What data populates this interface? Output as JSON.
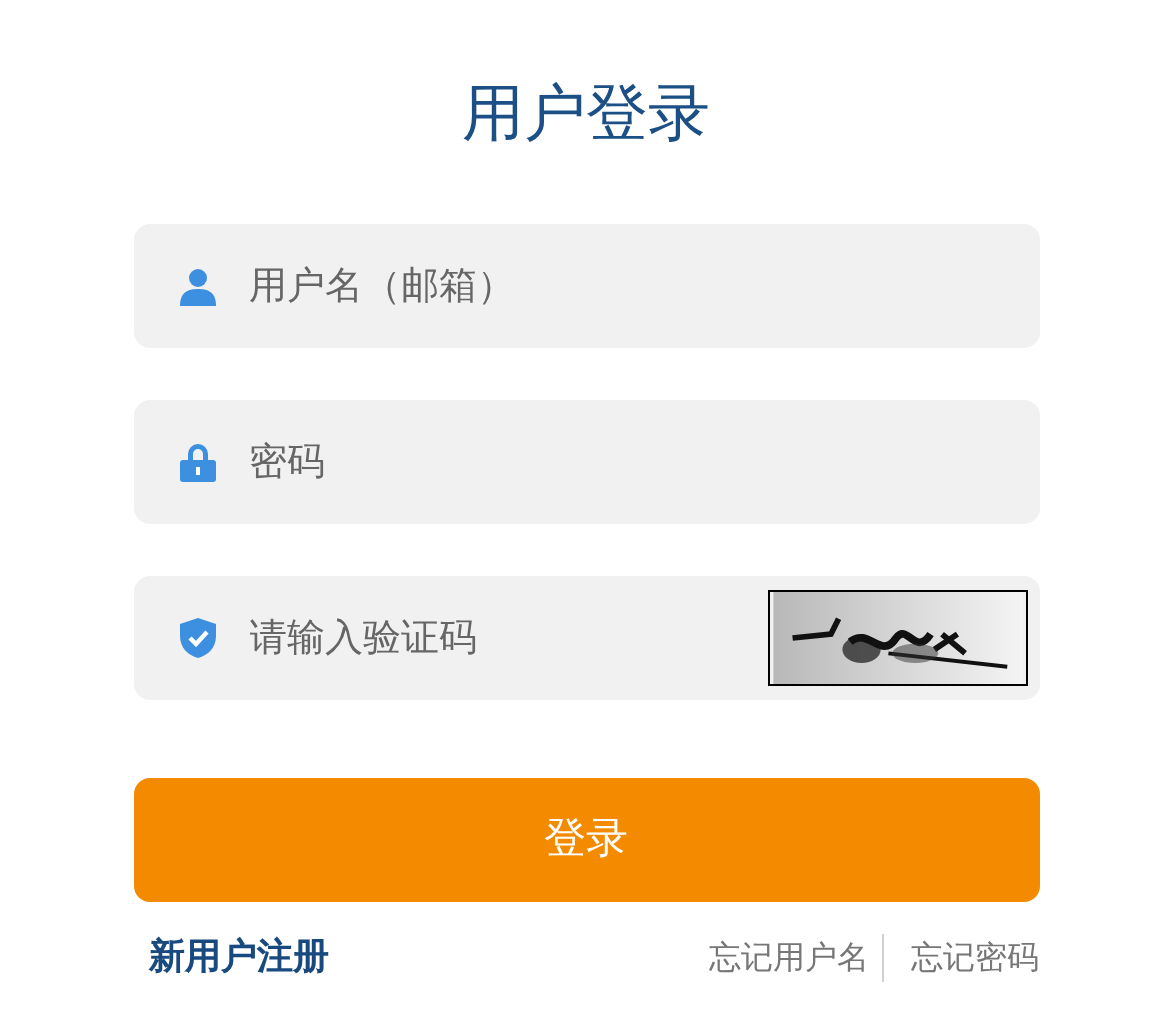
{
  "title": "用户登录",
  "fields": [
    {
      "kind": "text",
      "placeholder": "用户名（邮箱）"
    },
    {
      "kind": "password",
      "placeholder": "密码"
    },
    {
      "kind": "captcha",
      "placeholder": "请输入验证码"
    }
  ],
  "submit": "登录",
  "register_link": "新用户注册",
  "help_links": [
    "忘记用户名",
    "忘记密码"
  ]
}
